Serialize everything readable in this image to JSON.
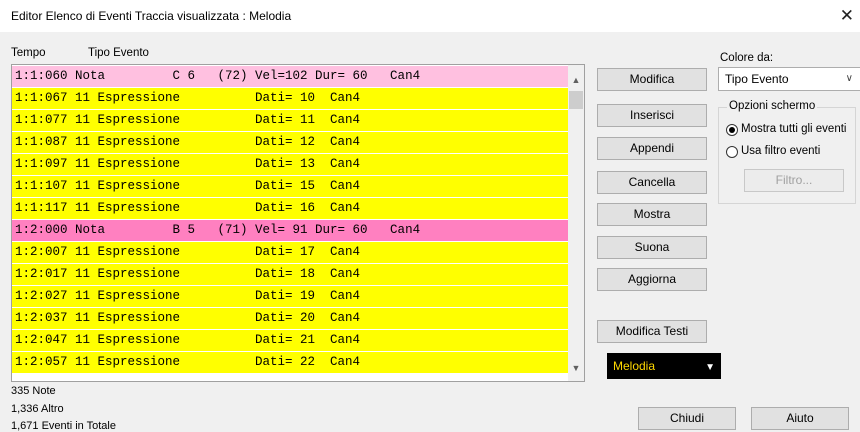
{
  "window": {
    "title": "Editor Elenco di Eventi  Traccia visualizzata : Melodia"
  },
  "headers": {
    "tempo": "Tempo",
    "tipo": "Tipo Evento"
  },
  "events": [
    {
      "text": "1:1:060 Nota         C 6   (72) Vel=102 Dur= 60   Can4",
      "type": "note-selected"
    },
    {
      "text": "1:1:067 11 Espressione          Dati= 10  Can4",
      "type": "expr"
    },
    {
      "text": "1:1:077 11 Espressione          Dati= 11  Can4",
      "type": "expr"
    },
    {
      "text": "1:1:087 11 Espressione          Dati= 12  Can4",
      "type": "expr"
    },
    {
      "text": "1:1:097 11 Espressione          Dati= 13  Can4",
      "type": "expr"
    },
    {
      "text": "1:1:107 11 Espressione          Dati= 15  Can4",
      "type": "expr"
    },
    {
      "text": "1:1:117 11 Espressione          Dati= 16  Can4",
      "type": "expr"
    },
    {
      "text": "1:2:000 Nota         B 5   (71) Vel= 91 Dur= 60   Can4",
      "type": "note"
    },
    {
      "text": "1:2:007 11 Espressione          Dati= 17  Can4",
      "type": "expr"
    },
    {
      "text": "1:2:017 11 Espressione          Dati= 18  Can4",
      "type": "expr"
    },
    {
      "text": "1:2:027 11 Espressione          Dati= 19  Can4",
      "type": "expr"
    },
    {
      "text": "1:2:037 11 Espressione          Dati= 20  Can4",
      "type": "expr"
    },
    {
      "text": "1:2:047 11 Espressione          Dati= 21  Can4",
      "type": "expr"
    },
    {
      "text": "1:2:057 11 Espressione          Dati= 22  Can4",
      "type": "expr"
    }
  ],
  "buttons": {
    "modifica": "Modifica",
    "inserisci": "Inserisci",
    "appendi": "Appendi",
    "cancella": "Cancella",
    "mostra": "Mostra",
    "suona": "Suona",
    "aggiorna": "Aggiorna",
    "modifica_testi": "Modifica Testi",
    "chiudi": "Chiudi",
    "aiuto": "Aiuto",
    "filtro": "Filtro..."
  },
  "colore": {
    "label": "Colore da:",
    "value": "Tipo Evento"
  },
  "opzioni": {
    "title": "Opzioni schermo",
    "mostra_tutti": "Mostra tutti gli eventi",
    "usa_filtro": "Usa filtro eventi",
    "selected": "mostra_tutti"
  },
  "track": {
    "value": "Melodia"
  },
  "status": {
    "note": "335 Note",
    "altro": "1,336 Altro",
    "totale": "1,671 Eventi in Totale"
  },
  "icons": {
    "close": "close-icon",
    "scroll_up": "chevron-up-icon",
    "scroll_down": "chevron-down-icon",
    "dropdown": "chevron-down-icon"
  },
  "colors": {
    "expr": "#ffff00",
    "note": "#ff80c0",
    "note_selected": "#ffc0e0",
    "track_text": "#ffd800"
  }
}
